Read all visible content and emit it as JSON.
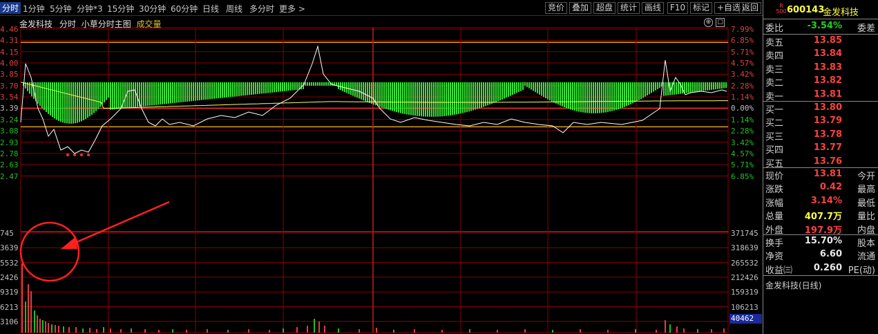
{
  "toolbar": {
    "periods": [
      "分时",
      "1分钟",
      "5分钟",
      "分钟*3",
      "15分钟",
      "30分钟",
      "60分钟",
      "日线",
      "周线",
      "多分时",
      "更多 >"
    ],
    "tools": [
      "竞价",
      "叠加",
      "超盘",
      "统计",
      "画线",
      "F10",
      "标记",
      "+自选",
      "返回"
    ]
  },
  "chart_header": {
    "stock_name": "金发科技",
    "mode": "分时",
    "subtitle": "小草分时主图",
    "volume_label": "成交量"
  },
  "price_axis": {
    "left": [
      "4.46",
      "4.31",
      "4.15",
      "4.00",
      "3.85",
      "3.70",
      "3.54",
      "3.39",
      "3.24",
      "3.08",
      "2.93",
      "2.78",
      "2.63",
      "2.47"
    ],
    "right": [
      "7.99%",
      "6.85%",
      "5.71%",
      "4.57%",
      "3.42%",
      "2.28%",
      "1.14%",
      "0.00%",
      "1.14%",
      "2.28%",
      "3.42%",
      "4.57%",
      "5.71%",
      "6.85%"
    ]
  },
  "volume_axis": {
    "left": [
      "745",
      "3639",
      "5532",
      "2426",
      "9319",
      "6213",
      "3106"
    ],
    "right": [
      "371745",
      "318639",
      "265532",
      "212426",
      "159319",
      "106213",
      "53106"
    ],
    "current": "40462"
  },
  "colors": {
    "up": "#e04040",
    "down": "#20c020",
    "grass": "#33e533",
    "line": "#ffffff",
    "avg": "#ffff66",
    "grid": "#8b0000"
  },
  "quote": {
    "badge_top": "R",
    "badge_bottom": "500",
    "code": "600143",
    "name": "金发科技",
    "weibi_label": "委比",
    "weibi_value": "-3.54%",
    "weicha_label": "委差",
    "asks": [
      {
        "label": "卖五",
        "price": "13.85"
      },
      {
        "label": "卖四",
        "price": "13.84"
      },
      {
        "label": "卖三",
        "price": "13.83"
      },
      {
        "label": "卖二",
        "price": "13.82"
      },
      {
        "label": "卖一",
        "price": "13.81"
      }
    ],
    "bids": [
      {
        "label": "买一",
        "price": "13.80"
      },
      {
        "label": "买二",
        "price": "13.79"
      },
      {
        "label": "买三",
        "price": "13.78"
      },
      {
        "label": "买四",
        "price": "13.77"
      },
      {
        "label": "买五",
        "price": "13.76"
      }
    ],
    "stats1": [
      {
        "k": "现价",
        "v": "13.81",
        "k2": "今开"
      },
      {
        "k": "涨跌",
        "v": "0.42",
        "k2": "最高"
      },
      {
        "k": "涨幅",
        "v": "3.14%",
        "k2": "最低"
      },
      {
        "k": "总量",
        "v": "407.7万",
        "k2": "量比"
      },
      {
        "k": "外盘",
        "v": "197.9万",
        "k2": "内盘"
      }
    ],
    "stats2": [
      {
        "k": "换手",
        "v": "15.70%",
        "k2": "股本"
      },
      {
        "k": "净资",
        "v": "6.60",
        "k2": "流通"
      },
      {
        "k": "收益㈢",
        "v": "0.260",
        "k2": "PE(动)"
      }
    ],
    "footer": "金发科技(日线)"
  }
}
